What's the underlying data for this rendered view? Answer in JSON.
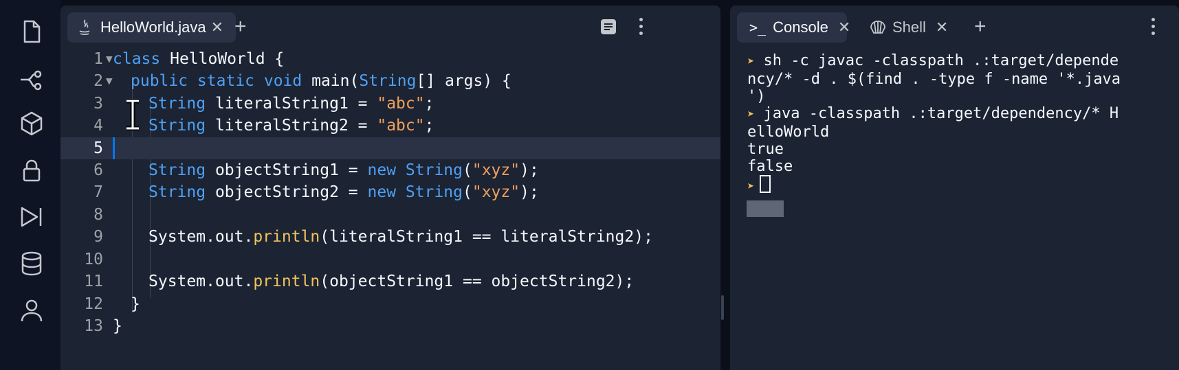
{
  "sidebar": {
    "icons": [
      "file-icon",
      "git-branch-icon",
      "package-icon",
      "lock-icon",
      "run-step-icon",
      "database-icon",
      "user-icon"
    ]
  },
  "editor": {
    "tab": {
      "label": "HelloWorld.java"
    },
    "lines": [
      {
        "num": "1",
        "text": "class HelloWorld {"
      },
      {
        "num": "2",
        "text": "public static void main(String[] args) {"
      },
      {
        "num": "3",
        "text": "String literalString1 = \"abc\";"
      },
      {
        "num": "4",
        "text": "String literalString2 = \"abc\";"
      },
      {
        "num": "5",
        "text": ""
      },
      {
        "num": "6",
        "text": "String objectString1 = new String(\"xyz\");"
      },
      {
        "num": "7",
        "text": "String objectString2 = new String(\"xyz\");"
      },
      {
        "num": "8",
        "text": ""
      },
      {
        "num": "9",
        "text": "System.out.println(literalString1 == literalString2);"
      },
      {
        "num": "10",
        "text": ""
      },
      {
        "num": "11",
        "text": "System.out.println(objectString1 == objectString2);"
      },
      {
        "num": "12",
        "text": "}"
      },
      {
        "num": "13",
        "text": "}"
      }
    ]
  },
  "console": {
    "tabs": [
      {
        "label": "Console"
      },
      {
        "label": "Shell"
      }
    ],
    "output": [
      "sh -c javac -classpath .:target/depende",
      "ncy/* -d . $(find . -type f -name '*.java",
      "')",
      "java -classpath .:target/dependency/* H",
      "elloWorld",
      "true",
      "false"
    ]
  },
  "colors": {
    "accent": "#0079f2",
    "keyword": "#4ea1f3",
    "string": "#f0a05a",
    "method": "#f2c35c",
    "bg": "#1c2333"
  }
}
